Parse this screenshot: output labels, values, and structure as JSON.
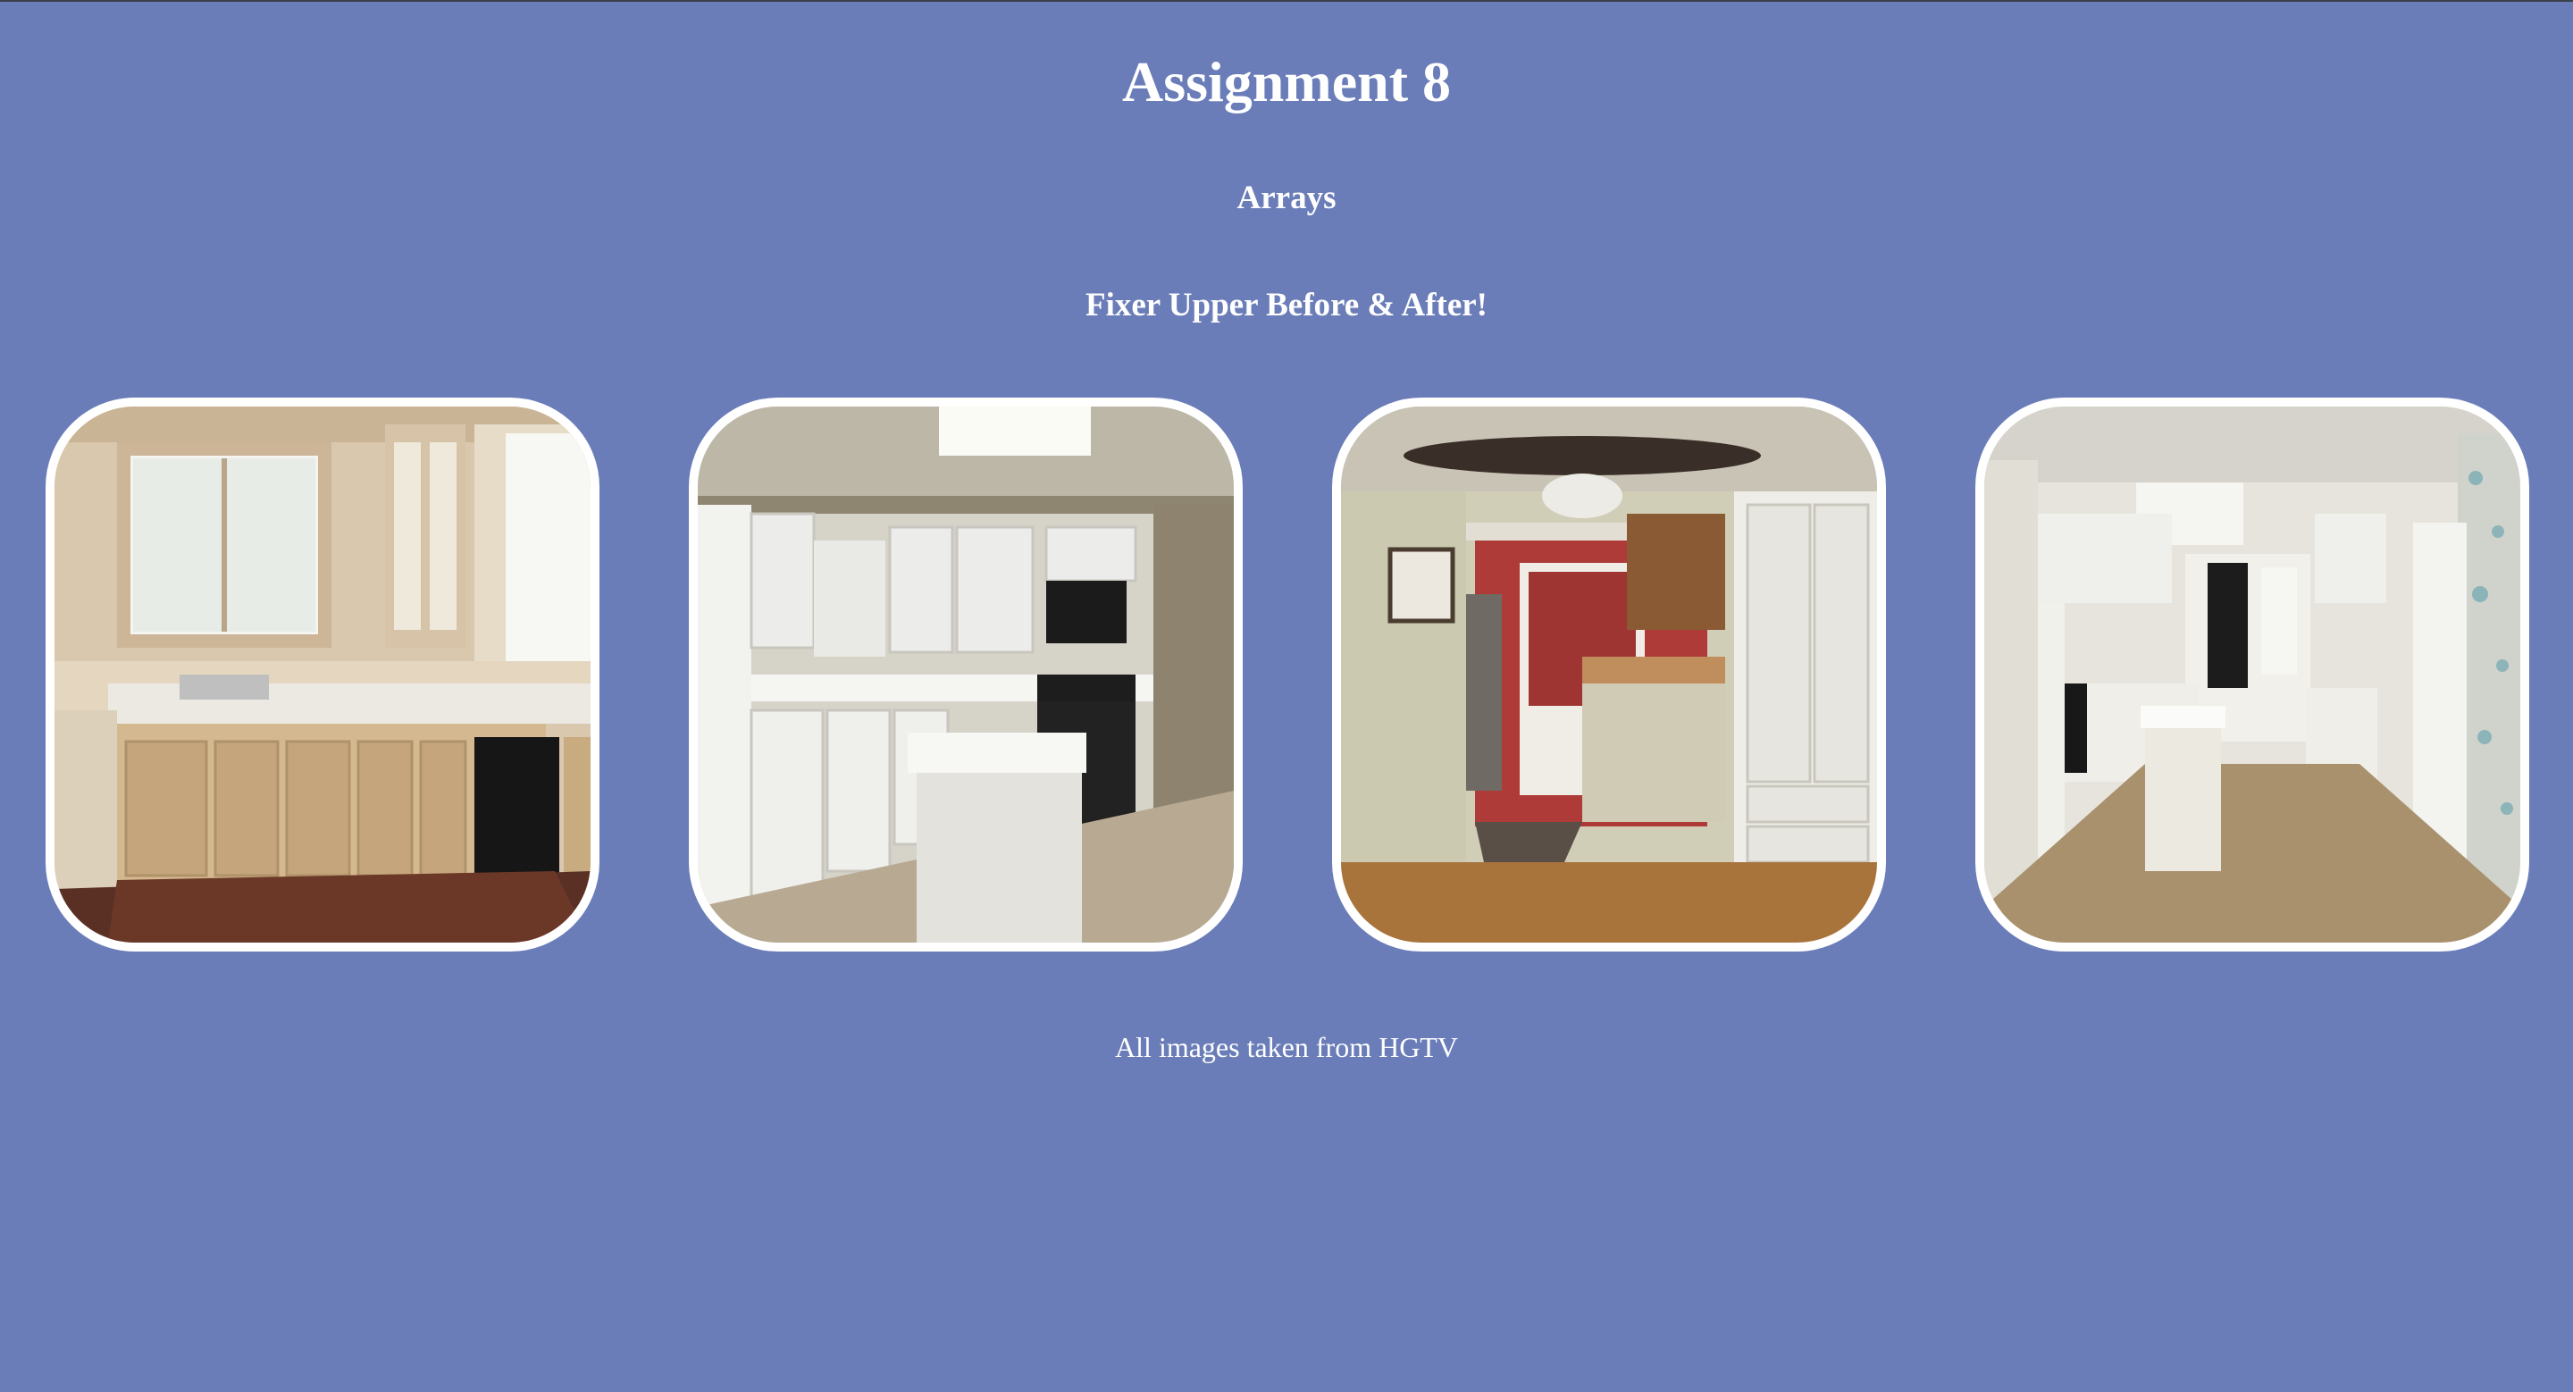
{
  "header": {
    "title": "Assignment 8",
    "subtitle": "Arrays",
    "section_heading": "Fixer Upper Before & After!"
  },
  "gallery": {
    "images": [
      {
        "name": "kitchen-before-1",
        "alt": "Kitchen photo 1"
      },
      {
        "name": "kitchen-after-1",
        "alt": "Kitchen photo 2"
      },
      {
        "name": "kitchen-before-2",
        "alt": "Kitchen photo 3"
      },
      {
        "name": "kitchen-after-2",
        "alt": "Kitchen photo 4"
      }
    ]
  },
  "footer": {
    "credit": "All images taken from HGTV"
  },
  "colors": {
    "background": "#6a7db8",
    "text": "#ffffff",
    "image_border": "#ffffff"
  }
}
